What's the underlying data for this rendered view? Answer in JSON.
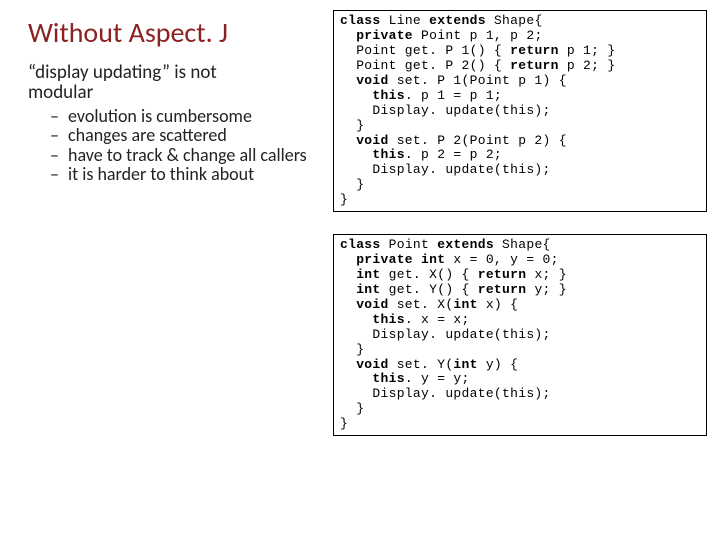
{
  "title": "Without Aspect. J",
  "subtitle_line1": "“display updating” is not",
  "subtitle_line2": "modular",
  "bullets": [
    "evolution is cumbersome",
    "changes are scattered",
    "have to track & change all callers",
    "it is harder to think about"
  ],
  "code1": {
    "l01a": "class",
    "l01b": " Line ",
    "l01c": "extends",
    "l01d": " Shape{",
    "l02a": "  private",
    "l02b": " Point p 1, p 2;",
    "l03a": "  Point get. P 1() { ",
    "l03b": "return",
    "l03c": " p 1; }",
    "l04a": "  Point get. P 2() { ",
    "l04b": "return",
    "l04c": " p 2; }",
    "l05a": "  void",
    "l05b": " set. P 1(Point p 1) {",
    "l06a": "    this",
    "l06b": ". p 1 = p 1;",
    "l07": "    Display. update(this);",
    "l08": "  }",
    "l09a": "  void",
    "l09b": " set. P 2(Point p 2) {",
    "l10a": "    this",
    "l10b": ". p 2 = p 2;",
    "l11": "    Display. update(this);",
    "l12": "  }",
    "l13": "}"
  },
  "code2": {
    "l01a": "class",
    "l01b": " Point ",
    "l01c": "extends",
    "l01d": " Shape{",
    "l02a": "  private int",
    "l02b": " x = 0, y = 0;",
    "l03a": "  int",
    "l03b": " get. X() { ",
    "l03c": "return",
    "l03d": " x; }",
    "l04a": "  int",
    "l04b": " get. Y() { ",
    "l04c": "return",
    "l04d": " y; }",
    "l05a": "  void",
    "l05b": " set. X(",
    "l05c": "int",
    "l05d": " x) {",
    "l06a": "    this",
    "l06b": ". x = x;",
    "l07": "    Display. update(this);",
    "l08": "  }",
    "l09a": "  void",
    "l09b": " set. Y(",
    "l09c": "int",
    "l09d": " y) {",
    "l10a": "    this",
    "l10b": ". y = y;",
    "l11": "    Display. update(this);",
    "l12": "  }",
    "l13": "}"
  }
}
